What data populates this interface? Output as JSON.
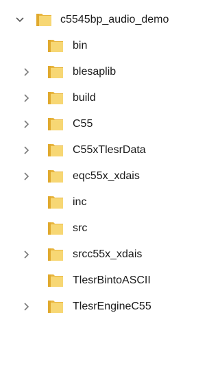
{
  "tree": {
    "root": {
      "label": "c5545bp_audio_demo",
      "expanded": true,
      "icon": "folder-icon"
    },
    "children": [
      {
        "label": "bin",
        "has_children": false
      },
      {
        "label": "blesaplib",
        "has_children": true
      },
      {
        "label": "build",
        "has_children": true
      },
      {
        "label": "C55",
        "has_children": true
      },
      {
        "label": "C55xTlesrData",
        "has_children": true
      },
      {
        "label": "eqc55x_xdais",
        "has_children": true
      },
      {
        "label": "inc",
        "has_children": false
      },
      {
        "label": "src",
        "has_children": false
      },
      {
        "label": "srcc55x_xdais",
        "has_children": true
      },
      {
        "label": "TlesrBintoASCII",
        "has_children": false
      },
      {
        "label": "TlesrEngineC55",
        "has_children": true
      }
    ]
  },
  "colors": {
    "folder": "#f7d774",
    "folder_dark": "#e8b53e",
    "chevron": "#7a7a7a"
  }
}
